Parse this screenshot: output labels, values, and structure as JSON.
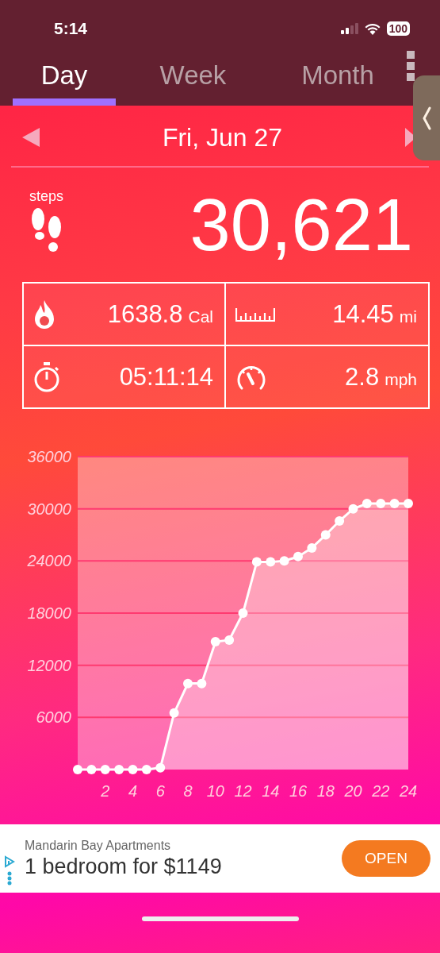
{
  "status_bar": {
    "time": "5:14",
    "battery": "100"
  },
  "tabs": [
    {
      "label": "Day",
      "selected": true
    },
    {
      "label": "Week",
      "selected": false
    },
    {
      "label": "Month",
      "selected": false
    }
  ],
  "date": "Fri, Jun 27",
  "steps": {
    "label": "steps",
    "value": "30,621"
  },
  "stats": [
    {
      "kind": "calories",
      "value": "1638.8",
      "unit": "Cal"
    },
    {
      "kind": "distance",
      "value": "14.45",
      "unit": "mi"
    },
    {
      "kind": "duration",
      "value": "05:11:14"
    },
    {
      "kind": "speed",
      "value": "2.8",
      "unit": "mph"
    }
  ],
  "chart_data": {
    "type": "area",
    "x": [
      0,
      1,
      2,
      3,
      4,
      5,
      6,
      7,
      8,
      9,
      10,
      11,
      12,
      13,
      14,
      15,
      16,
      17,
      18,
      19,
      20,
      21,
      22,
      23,
      24
    ],
    "series": [
      {
        "color": "#ffffff",
        "values": [
          0,
          0,
          0,
          0,
          0,
          0,
          200,
          6500,
          9900,
          9900,
          14700,
          14900,
          18000,
          23900,
          23900,
          24000,
          24500,
          25500,
          27000,
          28600,
          30000,
          30600,
          30600,
          30600,
          30600
        ]
      }
    ],
    "grid": true,
    "xlim": [
      0,
      24
    ],
    "ylim": [
      0,
      36000
    ],
    "xticks": [
      2,
      4,
      6,
      8,
      10,
      12,
      14,
      16,
      18,
      20,
      22,
      24
    ],
    "yticks": [
      6000,
      12000,
      18000,
      24000,
      30000,
      36000
    ]
  },
  "ad": {
    "advertiser": "Mandarin Bay Apartments",
    "headline": "1 bedroom for $1149",
    "button": "OPEN"
  }
}
